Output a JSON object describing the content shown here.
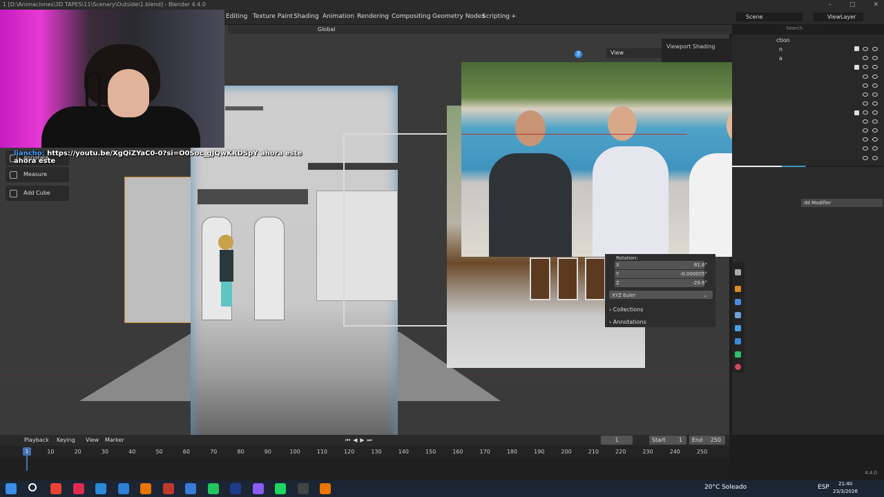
{
  "window": {
    "title": "1 [D:\\Animaciones\\3D TAPES\\11\\Scenary\\Outside\\1.blend] - Blender 4.4.0",
    "minimize": "–",
    "maximize": "□",
    "close": "✕"
  },
  "workspaces": [
    "Editing",
    "Texture Paint",
    "Shading",
    "Animation",
    "Rendering",
    "Compositing",
    "Geometry Nodes",
    "Scripting",
    "+"
  ],
  "scene_name": "Scene",
  "view_layer": "ViewLayer",
  "search_placeholder": "Search",
  "viewport_header": {
    "orientation": "Global"
  },
  "chat": {
    "user": "liancho:",
    "message": "https://youtu.be/XgQiZYaC0-0?si=O0Soc_gJQwKRDSpY ahora este ahora este"
  },
  "tools": [
    "Annotate",
    "Measure",
    "Add Cube"
  ],
  "view_button": "View",
  "viewport_shading_label": "Viewport Shading",
  "properties": {
    "rotation_label": "Rotation:",
    "x": {
      "label": "X",
      "value": "81.6°"
    },
    "y": {
      "label": "Y",
      "value": "-0.000005°"
    },
    "z": {
      "label": "Z",
      "value": "-29.6°"
    },
    "mode": "XYZ Euler",
    "collections": "Collections",
    "annotations": "Annotations"
  },
  "outliner_partial": [
    "ction",
    "n",
    "a"
  ],
  "modifier_button": "dd Modifier",
  "gizmo_z": "Z",
  "timeline": {
    "menus": [
      "Playback",
      "Keying",
      "View",
      "Marker"
    ],
    "current_frame": "1",
    "start_label": "Start",
    "start": "1",
    "end_label": "End",
    "end": "250",
    "ruler": [
      "1",
      "10",
      "20",
      "30",
      "40",
      "50",
      "60",
      "70",
      "80",
      "90",
      "100",
      "110",
      "120",
      "130",
      "140",
      "150",
      "160",
      "170",
      "180",
      "190",
      "200",
      "210",
      "220",
      "230",
      "240",
      "250"
    ]
  },
  "version": "4.4.0",
  "taskbar": {
    "weather": "20°C  Soleado",
    "lang": "ESP",
    "time": "21:40",
    "date": "23/3/2026",
    "apps": [
      "start",
      "search",
      "chrome",
      "opera",
      "edge",
      "app-blue",
      "blender",
      "obs",
      "photoshop",
      "pycharm",
      "vscode",
      "app-purple",
      "spotify",
      "obs2",
      "blender2"
    ],
    "app_colors": [
      "#3b8ee8",
      "#ffffff",
      "#e84335",
      "#e02a4f",
      "#2c8ad8",
      "#2f7fd6",
      "#ea7600",
      "#c0392b",
      "#3a7ad8",
      "#21c55e",
      "#1e3a8a",
      "#8b5cf6",
      "#1ed760",
      "#444444",
      "#ea7600"
    ]
  }
}
